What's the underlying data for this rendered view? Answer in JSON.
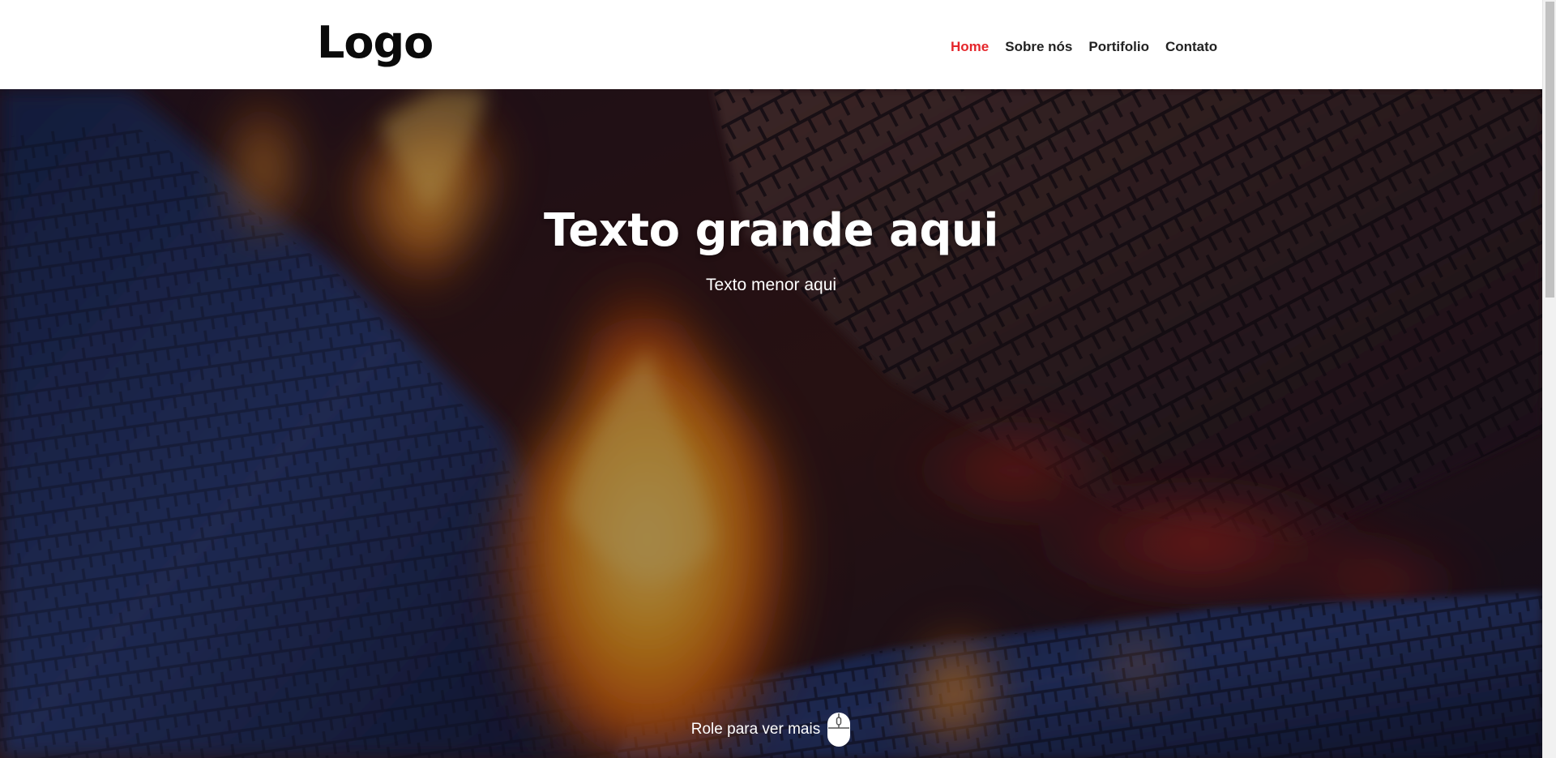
{
  "header": {
    "logo": "Logo",
    "nav": [
      {
        "label": "Home",
        "active": true
      },
      {
        "label": "Sobre nós",
        "active": false
      },
      {
        "label": "Portifolio",
        "active": false
      },
      {
        "label": "Contato",
        "active": false
      }
    ]
  },
  "hero": {
    "title": "Texto grande aqui",
    "subtitle": "Texto menor aqui",
    "scroll_hint": "Role para ver mais",
    "scroll_icon": "mouse-icon"
  },
  "colors": {
    "accent": "#e5262b",
    "nav_text": "#222222",
    "header_bg": "#ffffff",
    "hero_text": "#ffffff"
  }
}
